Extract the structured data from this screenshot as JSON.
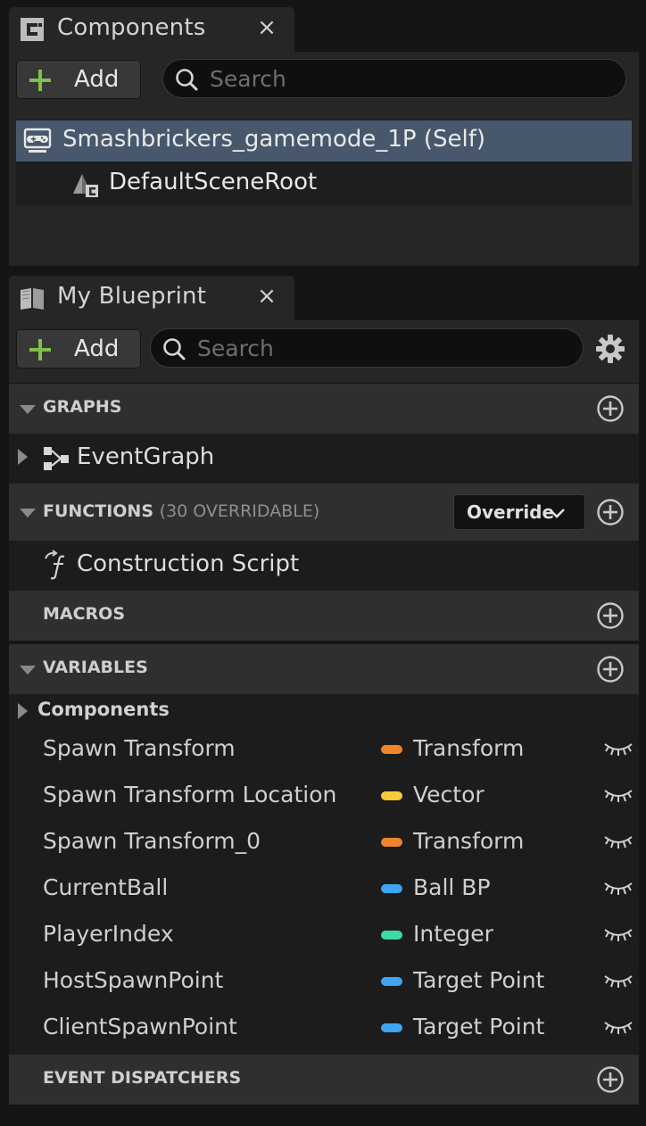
{
  "components_panel": {
    "tab_title": "Components",
    "close_glyph": "×",
    "add_label": "Add",
    "search_placeholder": "Search",
    "tree": [
      {
        "label": "Smashbrickers_gamemode_1P (Self)",
        "icon": "gamepad-icon",
        "selected": true
      },
      {
        "label": "DefaultSceneRoot",
        "icon": "scene-root-icon",
        "selected": false
      }
    ]
  },
  "blueprint_panel": {
    "tab_title": "My Blueprint",
    "close_glyph": "×",
    "add_label": "Add",
    "search_placeholder": "Search",
    "settings_icon": "gear-icon",
    "sections": {
      "graphs": {
        "title": "GRAPHS",
        "items": [
          {
            "label": "EventGraph",
            "icon": "event-graph-icon"
          }
        ]
      },
      "functions": {
        "title": "FUNCTIONS",
        "subtitle": "(30 OVERRIDABLE)",
        "override_label": "Override",
        "items": [
          {
            "label": "Construction Script",
            "icon": "function-icon"
          }
        ]
      },
      "macros": {
        "title": "MACROS"
      },
      "variables": {
        "title": "VARIABLES",
        "group_label": "Components",
        "items": [
          {
            "name": "Spawn Transform",
            "type": "Transform",
            "color": "#f0842c"
          },
          {
            "name": "Spawn Transform Location",
            "type": "Vector",
            "color": "#f9c93a"
          },
          {
            "name": "Spawn Transform_0",
            "type": "Transform",
            "color": "#f0842c"
          },
          {
            "name": "CurrentBall",
            "type": "Ball BP",
            "color": "#3ea6f0"
          },
          {
            "name": "PlayerIndex",
            "type": "Integer",
            "color": "#3fd8a8"
          },
          {
            "name": "HostSpawnPoint",
            "type": "Target Point",
            "color": "#3ea6f0"
          },
          {
            "name": "ClientSpawnPoint",
            "type": "Target Point",
            "color": "#3ea6f0"
          }
        ]
      },
      "event_dispatchers": {
        "title": "EVENT DISPATCHERS"
      }
    }
  }
}
